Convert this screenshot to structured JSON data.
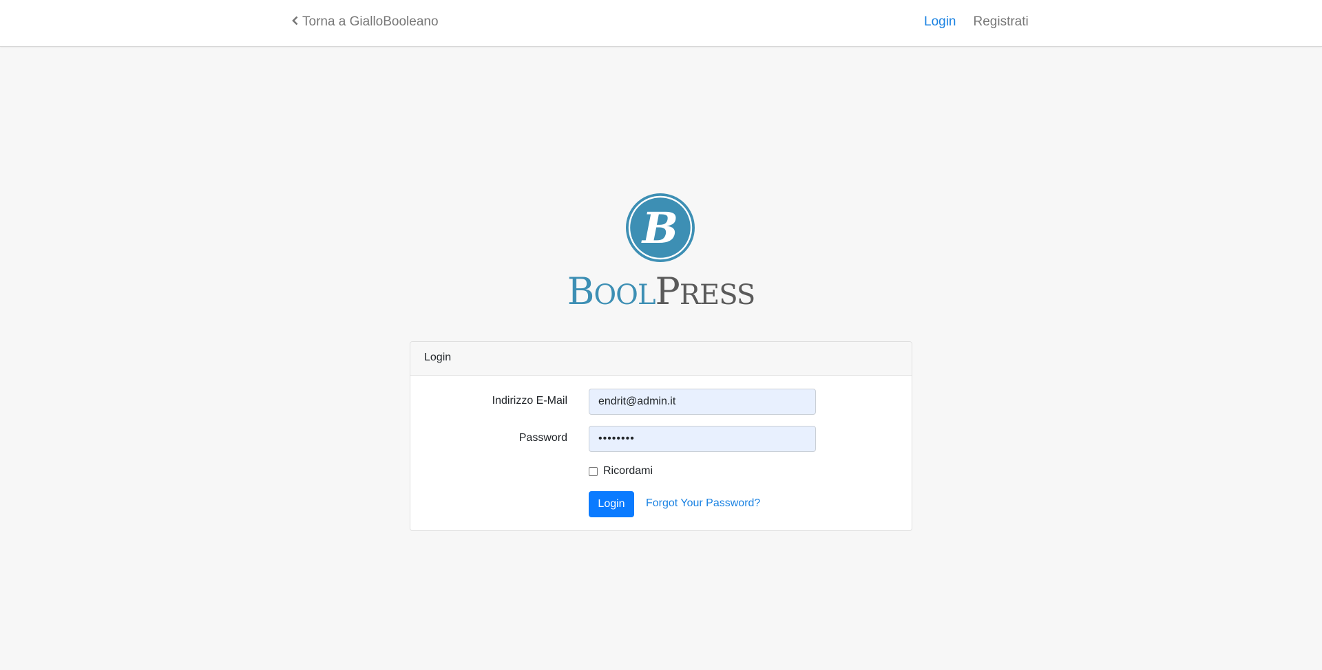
{
  "nav": {
    "back_label": "Torna a GialloBooleano",
    "login_label": "Login",
    "register_label": "Registrati"
  },
  "logo": {
    "initial": "B",
    "word_bool_first": "B",
    "word_bool_rest": "OOL",
    "word_press_first": "P",
    "word_press_rest": "RESS"
  },
  "login_card": {
    "header": "Login",
    "email_label": "Indirizzo E-Mail",
    "email_value": "endrit@admin.it",
    "password_label": "Password",
    "password_value": "••••••••",
    "remember_label": "Ricordami",
    "remember_checked": false,
    "submit_label": "Login",
    "forgot_label": "Forgot Your Password?"
  },
  "colors": {
    "brand_blue": "#3d8fb4",
    "brand_gray": "#5a5a5a",
    "link_blue": "#1a82e2",
    "button_blue": "#0b7bff",
    "autofill_bg": "#e8f0fe"
  },
  "icons": {
    "back": "chevron-left-icon"
  }
}
